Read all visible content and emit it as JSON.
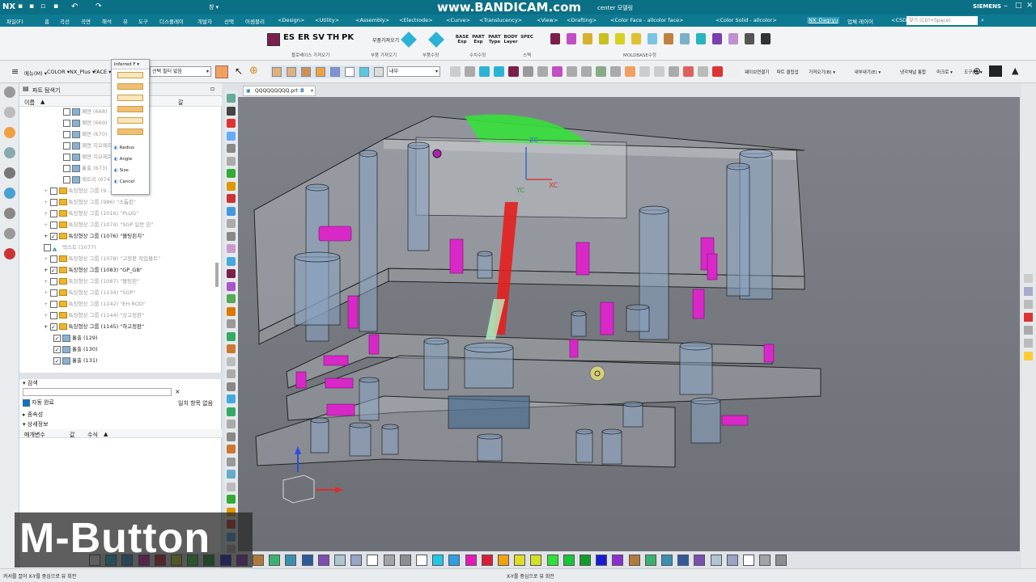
{
  "title": {
    "app": "NX",
    "watermark": "www.BANDICAM.com",
    "center": "center 모델링",
    "brand": "SIEMENS",
    "search_placeholder": "찾기 (Ctrl+Space)",
    "window_menu": "창 ▾",
    "window2": "창 ▾"
  },
  "menu": [
    "파일(F)",
    "홈",
    "곡선",
    "곡면",
    "해석",
    "뷰",
    "도구",
    "디스플레이",
    "개발자",
    "선택",
    "어셈블리",
    "<Design>",
    "<Utility>",
    "<Assembly>",
    "<Electrode>",
    "<Curve>",
    "<Translucency>",
    "<View>",
    "<Drafting>",
    "<Color Face - allcolor face>",
    "<Color Solid - allcolor>",
    "NX_Dagryu",
    "업체 레이어",
    "<CSDG>"
  ],
  "ribbon": {
    "groups": [
      "플로베이스 가져오기",
      "부품 가져오기",
      "부품수정",
      "수치수정",
      "스펙",
      "MOLDBASE수정"
    ],
    "big_buttons": [
      "ES",
      "ER",
      "SV",
      "TH",
      "PK"
    ],
    "small_label": "부품가져오기",
    "base_btns": [
      "BASE Exp",
      "PART Exp",
      "PART Type",
      "BODY Layer",
      "SPEC"
    ]
  },
  "toolbar2": {
    "menu_label": "메뉴(M) ▾",
    "color_label": "COLOR ▾",
    "nxplus": "NX_Plus ▾",
    "face_label": "FACE ▾",
    "filter_label": "선택 필터 없음",
    "scope_label": "내부",
    "right_labels": [
      "웨이브연결기",
      "파트 클립업",
      "가져오기(B) ▾",
      "내부내기(E) ▾",
      "냉각채널 통합",
      "마크로 ▾",
      "도구(E) ▾"
    ]
  },
  "snap_popup": {
    "title": "Inferred F",
    "items": [
      "Radius",
      "Angle",
      "Size",
      "Cancel"
    ]
  },
  "nav": {
    "title": "파트 탐색기",
    "col_name": "이름",
    "col_up": "▲",
    "col_latest": "최",
    "col_mod": "갈",
    "rows": [
      {
        "label": "페면 (668)",
        "checked": false,
        "type": "part",
        "indent": 4,
        "dim": true
      },
      {
        "label": "페면 (669)",
        "checked": false,
        "type": "part",
        "indent": 4,
        "dim": true
      },
      {
        "label": "페면 (670)",
        "checked": false,
        "type": "part",
        "indent": 4,
        "dim": true
      },
      {
        "label": "페면 지오메트리 (671)",
        "checked": false,
        "type": "part",
        "indent": 4,
        "dim": true
      },
      {
        "label": "페면 지오메트리 (672)",
        "checked": false,
        "type": "part",
        "indent": 4,
        "dim": true
      },
      {
        "label": "홀출 (673)",
        "checked": false,
        "type": "part",
        "indent": 4,
        "dim": true
      },
      {
        "label": "메트리 (674)",
        "checked": false,
        "type": "part",
        "indent": 4,
        "dim": true
      },
      {
        "label": "특징형상 그룹 (9...",
        "checked": false,
        "type": "folder",
        "indent": 2,
        "dim": true
      },
      {
        "label": "특징형상 그룹 (986) \"스톱핀\"",
        "checked": false,
        "type": "folder",
        "indent": 2,
        "dim": true
      },
      {
        "label": "특징형상 그룹 (1016) \"PLUG\"",
        "checked": false,
        "type": "folder",
        "indent": 2,
        "dim": true
      },
      {
        "label": "특징형상 그룹 (1074) \"SGP 일반 핀\"",
        "checked": false,
        "type": "folder",
        "indent": 2,
        "dim": true
      },
      {
        "label": "특징형상 그룹 (1076) \"볼팅핀치\"",
        "checked": true,
        "type": "folder",
        "indent": 2,
        "dim": false
      },
      {
        "label": "텍스트 (1077)",
        "checked": false,
        "type": "text",
        "indent": 2,
        "dim": true
      },
      {
        "label": "특징형상 그룹 (1078) \"고정판 작업볼트\"",
        "checked": false,
        "type": "folder",
        "indent": 2,
        "dim": true
      },
      {
        "label": "특징형상 그룹 (1083) \"GP_GB\"",
        "checked": true,
        "type": "folder",
        "indent": 2,
        "dim": false
      },
      {
        "label": "특징형상 그룹 (1087) \"볼팅핀\"",
        "checked": false,
        "type": "folder",
        "indent": 2,
        "dim": true
      },
      {
        "label": "특징형상 그룹 (1134) \"SGP\"",
        "checked": false,
        "type": "folder",
        "indent": 2,
        "dim": true
      },
      {
        "label": "특징형상 그룹 (1142) \"EH ROD\"",
        "checked": false,
        "type": "folder",
        "indent": 2,
        "dim": true
      },
      {
        "label": "특징형상 그룹 (1144) \"상고정판\"",
        "checked": false,
        "type": "folder",
        "indent": 2,
        "dim": true
      },
      {
        "label": "특징형상 그룹 (1145) \"하고정판\"",
        "checked": true,
        "type": "folder",
        "indent": 2,
        "dim": false
      },
      {
        "label": "홀출 (129)",
        "checked": true,
        "type": "part",
        "indent": 3,
        "dim": false
      },
      {
        "label": "홀출 (130)",
        "checked": true,
        "type": "part",
        "indent": 3,
        "dim": false
      },
      {
        "label": "홀출 (131)",
        "checked": true,
        "type": "part",
        "indent": 3,
        "dim": false
      }
    ],
    "search_section": "검색",
    "auto_complete": "자동 완료",
    "match_label": "일치 항목 없음",
    "dependency": "종속성",
    "details": "상세정보",
    "col_param": "매개변수",
    "col_value": "값",
    "col_expr": "수식"
  },
  "graphics": {
    "tab": "QQQQQQQQQ.prt",
    "axes": {
      "xc": "XC",
      "yc": "YC",
      "zc": "ZC"
    }
  },
  "status": {
    "left": "커서를 끌어 X-Y를 중심으로 뷰 회전",
    "center": "X-Y를 중심으로 뷰 회전"
  },
  "overlay": {
    "caption": "M-Button"
  },
  "colors": [
    "#ffffff",
    "#22c7e5",
    "#2f9ee5",
    "#e619b8",
    "#d81f33",
    "#d3e024",
    "#2ee038",
    "#0f9c2b",
    "#1a1ad4",
    "#8b2fd2",
    "#b07a3b",
    "#3bb070",
    "#3a8fb0",
    "#2e5a9c",
    "#7b4fb0",
    "#b0c5d4",
    "#9aa4c4",
    "#ffffff",
    "#a0a4a8",
    "#8a8e92",
    "#ffffff",
    "#22c7e5",
    "#2f9ee5",
    "#e619b8",
    "#d81f33",
    "#f2a20f",
    "#e0dc24",
    "#d3e024",
    "#2ee038",
    "#1ac43a",
    "#0f9c2b",
    "#1a1ad4",
    "#8b2fd2",
    "#b07a3b",
    "#3bb070",
    "#3a8fb0",
    "#2e5a9c",
    "#7b4fb0",
    "#b0c5d4",
    "#9aa4c4",
    "#ffffff",
    "#a0a4a8",
    "#8a8e92"
  ]
}
